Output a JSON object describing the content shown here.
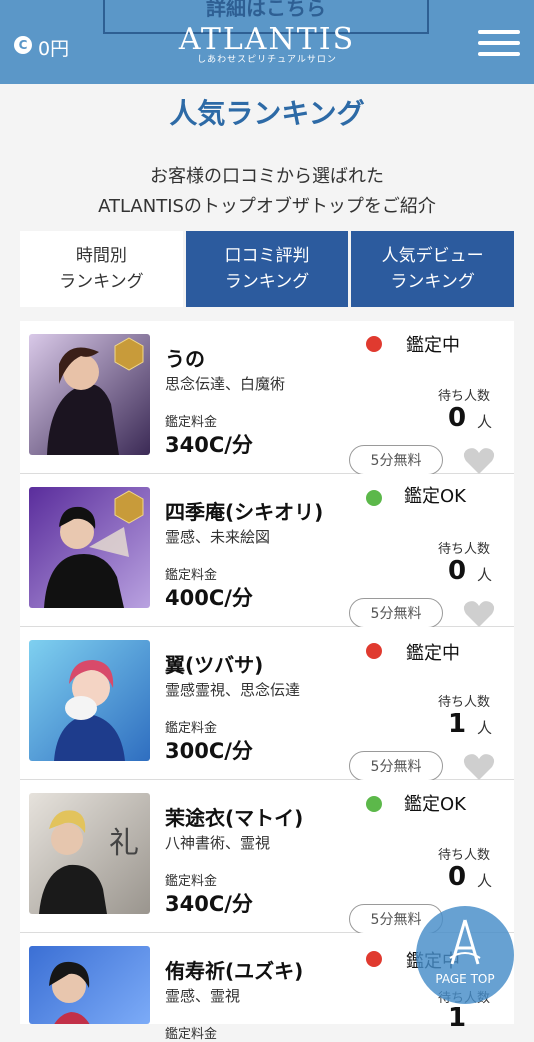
{
  "header": {
    "banner_text": "詳細はこちら",
    "coin_symbol": "C",
    "coin_value": "0円",
    "logo": "ATLANTIS",
    "logo_sub": "しあわせスピリチュアルサロン"
  },
  "page": {
    "title": "人気ランキング",
    "intro_line1": "お客様の口コミから選ばれた",
    "intro_line2": "ATLANTISのトップオブザトップをご紹介"
  },
  "tabs": [
    {
      "label": "時間別\nランキング",
      "active": true
    },
    {
      "label": "口コミ評判\nランキング",
      "active": false
    },
    {
      "label": "人気デビュー\nランキング",
      "active": false
    }
  ],
  "labels": {
    "fee": "鑑定料金",
    "waiting": "待ち人数",
    "person_unit": "人",
    "free_button": "5分無料"
  },
  "colors": {
    "header": "#5b97c8",
    "tab_active": "#ffffff",
    "tab_inactive": "#2c5b9e",
    "status_busy": "#e03a2f",
    "status_ok": "#5cb84a",
    "heart": "#cfcfcf"
  },
  "fortune_tellers": [
    {
      "name": "うの",
      "specialties": "思念伝達、白魔術",
      "fee": "340C/分",
      "status": "鑑定中",
      "status_type": "busy",
      "waiting": "0",
      "premium": true
    },
    {
      "name": "四季庵(シキオリ)",
      "specialties": "霊感、未来絵図",
      "fee": "400C/分",
      "status": "鑑定OK",
      "status_type": "ok",
      "waiting": "0",
      "premium": true
    },
    {
      "name": "翼(ツバサ)",
      "specialties": "霊感霊視、思念伝達",
      "fee": "300C/分",
      "status": "鑑定中",
      "status_type": "busy",
      "waiting": "1",
      "premium": false
    },
    {
      "name": "茉途衣(マトイ)",
      "specialties": "八神書術、霊視",
      "fee": "340C/分",
      "status": "鑑定OK",
      "status_type": "ok",
      "waiting": "0",
      "premium": false
    },
    {
      "name": "侑寿祈(ユズキ)",
      "specialties": "霊感、霊視",
      "fee": "",
      "status": "鑑定中",
      "status_type": "busy",
      "waiting": "1",
      "premium": false
    }
  ],
  "page_top": {
    "label": "PAGE TOP"
  }
}
